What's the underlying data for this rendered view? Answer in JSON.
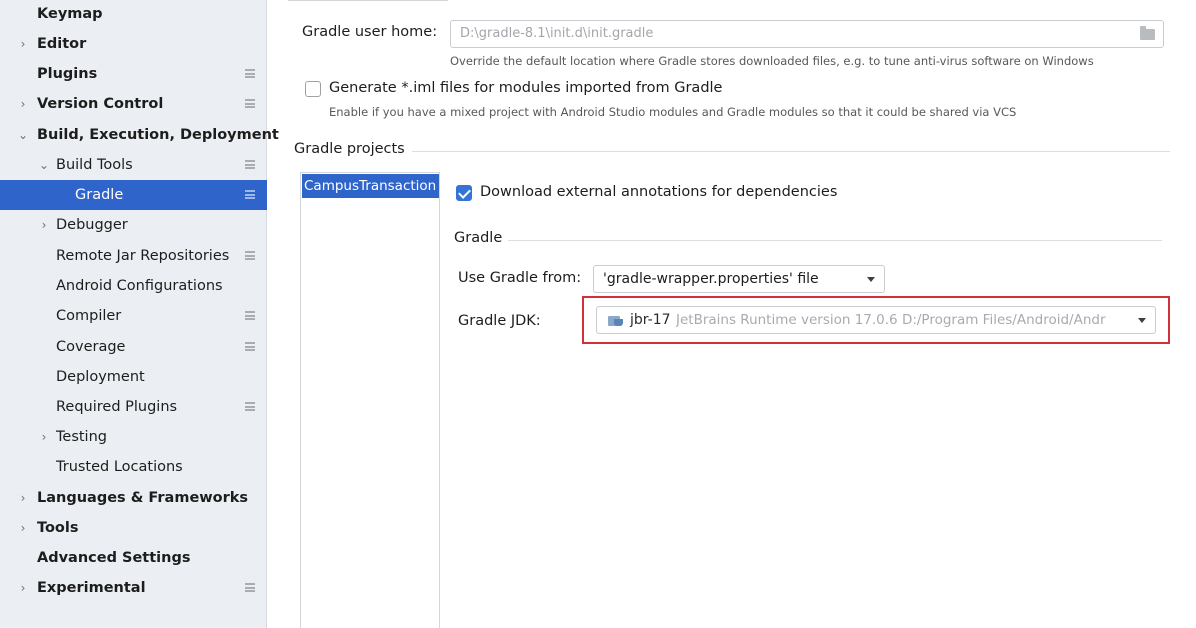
{
  "sidebar": {
    "items": [
      {
        "label": "Keymap"
      },
      {
        "label": "Editor"
      },
      {
        "label": "Plugins"
      },
      {
        "label": "Version Control"
      },
      {
        "label": "Build, Execution, Deployment"
      },
      {
        "label": "Build Tools"
      },
      {
        "label": "Gradle"
      },
      {
        "label": "Debugger"
      },
      {
        "label": "Remote Jar Repositories"
      },
      {
        "label": "Android Configurations"
      },
      {
        "label": "Compiler"
      },
      {
        "label": "Coverage"
      },
      {
        "label": "Deployment"
      },
      {
        "label": "Required Plugins"
      },
      {
        "label": "Testing"
      },
      {
        "label": "Trusted Locations"
      },
      {
        "label": "Languages & Frameworks"
      },
      {
        "label": "Tools"
      },
      {
        "label": "Advanced Settings"
      },
      {
        "label": "Experimental"
      }
    ],
    "selected": "Gradle"
  },
  "general": {
    "user_home_label": "Gradle user home:",
    "user_home_value": "D:\\gradle-8.1\\init.d\\init.gradle",
    "user_home_hint": "Override the default location where Gradle stores downloaded files, e.g. to tune anti-virus software on Windows",
    "iml_label": "Generate *.iml files for modules imported from Gradle",
    "iml_checked": false,
    "iml_hint": "Enable if you have a mixed project with Android Studio modules and Gradle modules so that it could be shared via VCS"
  },
  "projects": {
    "section_title": "Gradle projects",
    "items": [
      "CampusTransaction"
    ],
    "download_annotations_label": "Download external annotations for dependencies",
    "download_annotations_checked": true,
    "gradle_section_title": "Gradle",
    "use_gradle_from_label": "Use Gradle from:",
    "use_gradle_from_value": "'gradle-wrapper.properties' file",
    "gradle_jdk_label": "Gradle JDK:",
    "gradle_jdk_name": "jbr-17",
    "gradle_jdk_description": "JetBrains Runtime version 17.0.6 D:/Program Files/Android/Andr"
  },
  "colors": {
    "selection": "#2f65ca",
    "highlight_border": "#d0323c",
    "checkbox_checked": "#3574d4"
  }
}
